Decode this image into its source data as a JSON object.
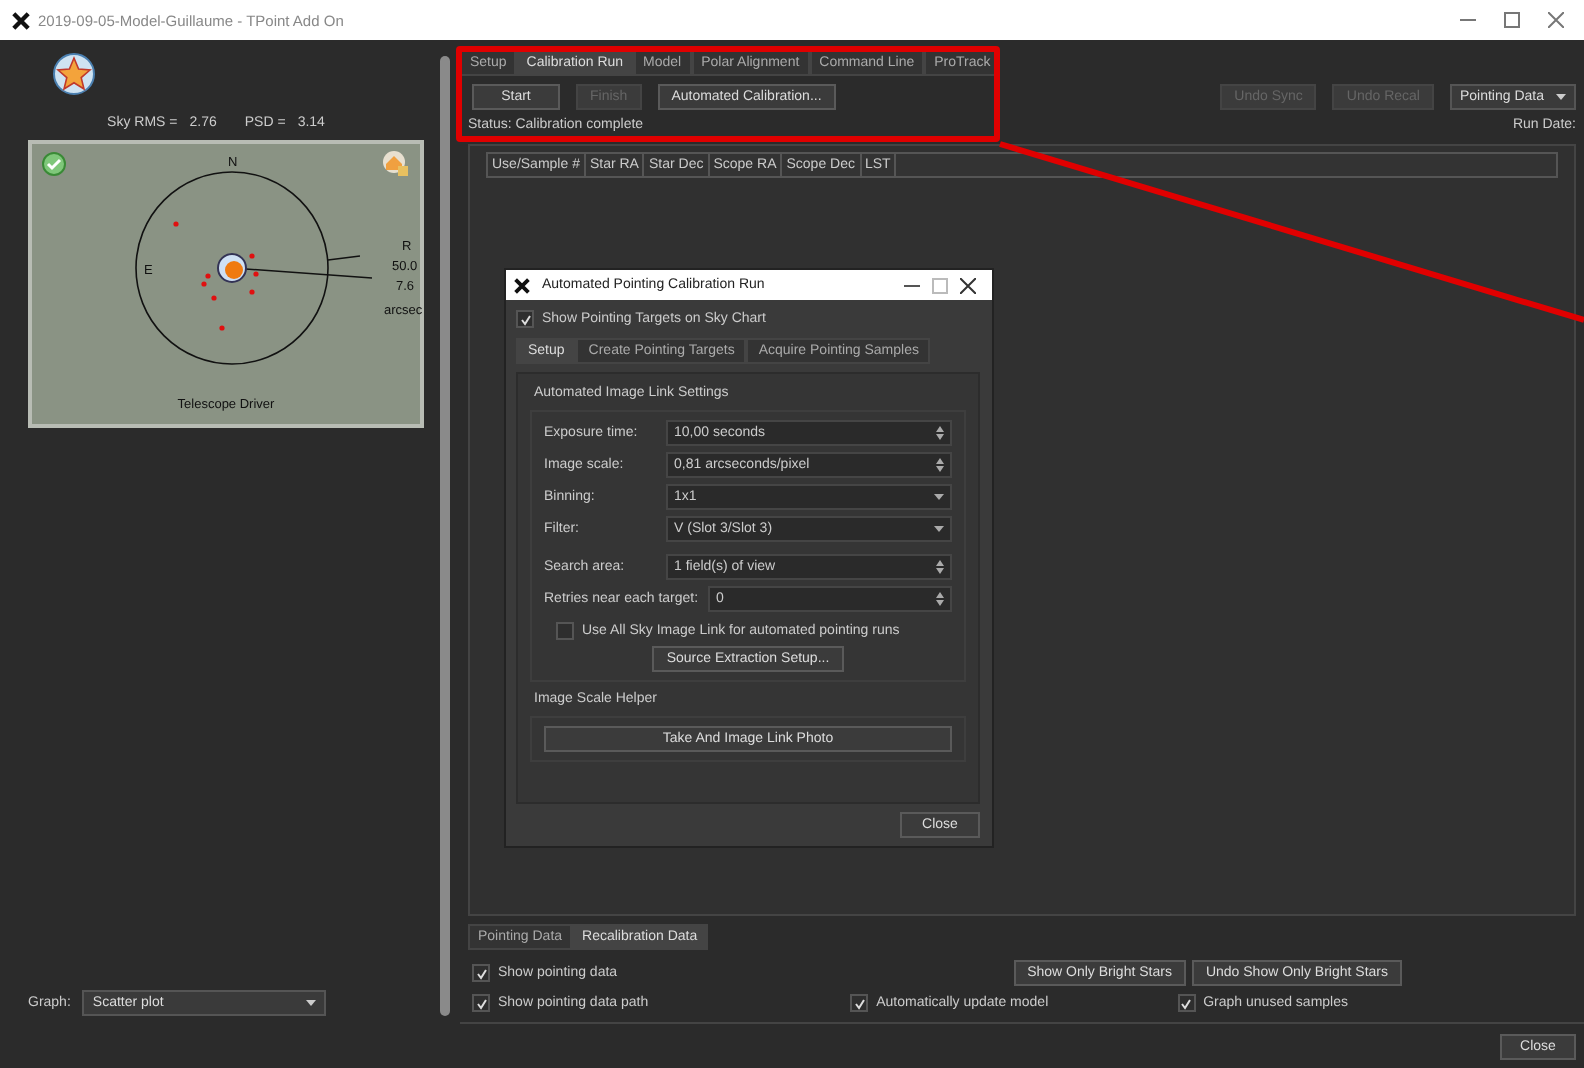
{
  "window": {
    "title": "2019-09-05-Model-Guillaume - TPoint Add On"
  },
  "left_panel": {
    "sky_rms_label": "Sky RMS =",
    "sky_rms": "2.76",
    "psd_label": "PSD =",
    "psd": "3.14",
    "plot": {
      "north": "N",
      "east": "E",
      "r_label": "R",
      "value_1": "50.0",
      "value_2": "7.6",
      "unit": "arcsec",
      "caption": "Telescope Driver"
    },
    "graph_label": "Graph:",
    "graph_value": "Scatter plot"
  },
  "tabs": [
    {
      "label": "Setup",
      "selected": false
    },
    {
      "label": "Calibration Run",
      "selected": true
    },
    {
      "label": "Model",
      "selected": false
    },
    {
      "label": "Polar Alignment",
      "selected": false
    },
    {
      "label": "Command Line",
      "selected": false
    },
    {
      "label": "ProTrack",
      "selected": false
    }
  ],
  "run_buttons": [
    {
      "label": "Start",
      "disabled": false
    },
    {
      "label": "Finish",
      "disabled": true
    },
    {
      "label": "Automated Calibration...",
      "disabled": false
    }
  ],
  "right_buttons": [
    {
      "label": "Undo Sync",
      "disabled": true
    },
    {
      "label": "Undo Recal",
      "disabled": true
    }
  ],
  "view_dropdown": "Pointing Data",
  "status": "Status: Calibration complete",
  "run_date": "Run Date:",
  "table": {
    "columns": [
      "Use/Sample #",
      "Star RA",
      "Star Dec",
      "Scope RA",
      "Scope Dec",
      "LST"
    ]
  },
  "bottom_tabs": [
    {
      "label": "Pointing Data",
      "selected": false
    },
    {
      "label": "Recalibration Data",
      "selected": true
    }
  ],
  "options": [
    {
      "label": "Show pointing data",
      "checked": true
    },
    {
      "label": "Show pointing data path",
      "checked": true
    },
    {
      "label": "Automatically update model",
      "checked": true
    },
    {
      "label": "Graph unused samples",
      "checked": true
    }
  ],
  "filter_buttons": [
    "Show Only Bright Stars",
    "Undo Show Only Bright Stars"
  ],
  "close_button": "Close",
  "dialog": {
    "title": "Automated Pointing Calibration Run",
    "show_targets": {
      "label": "Show Pointing Targets on Sky Chart",
      "checked": true
    },
    "tabs": [
      {
        "label": "Setup",
        "selected": true
      },
      {
        "label": "Create Pointing Targets",
        "selected": false
      },
      {
        "label": "Acquire Pointing Samples",
        "selected": false
      }
    ],
    "group_title": "Automated Image Link Settings",
    "fields": [
      {
        "label": "Exposure time:",
        "value": "10,00 seconds",
        "kind": "spin"
      },
      {
        "label": "Image scale:",
        "value": "0,81 arcseconds/pixel",
        "kind": "spin"
      },
      {
        "label": "Binning:",
        "value": "1x1",
        "kind": "dropdown"
      },
      {
        "label": "Filter:",
        "value": "V (Slot 3/Slot 3)",
        "kind": "dropdown"
      },
      {
        "label": "Search area:",
        "value": "1 field(s) of view",
        "kind": "spin"
      },
      {
        "label": "Retries near each target:",
        "value": "0",
        "kind": "spin"
      }
    ],
    "all_sky": {
      "label": "Use All Sky Image Link for automated pointing runs",
      "checked": false
    },
    "source_button": "Source Extraction Setup...",
    "helper_title": "Image Scale Helper",
    "photo_button": "Take And Image Link Photo",
    "close_button": "Close"
  }
}
